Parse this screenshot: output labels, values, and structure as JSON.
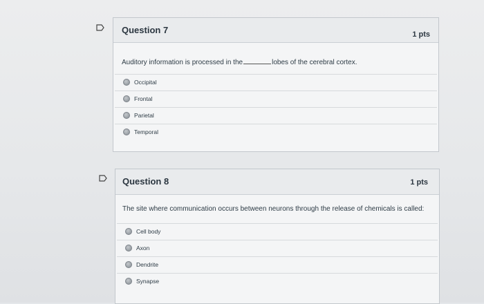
{
  "questions": [
    {
      "title": "Question 7",
      "points": "1 pts",
      "text_before": "Auditory information is processed in the",
      "text_after": "lobes of the cerebral cortex.",
      "answers": [
        "Occipital",
        "Frontal",
        "Parietal",
        "Temporal"
      ]
    },
    {
      "title": "Question 8",
      "points": "1 pts",
      "text": "The site where communication occurs between neurons through the release of chemicals is called:",
      "answers": [
        "Cell body",
        "Axon",
        "Dendrite",
        "Synapse"
      ]
    }
  ],
  "icons": {
    "flag": "flag-icon",
    "radio": "radio-button-icon"
  },
  "colors": {
    "header_bg": "#e9ebed",
    "card_bg": "#f4f5f6",
    "border": "#c2c7cc",
    "text": "#2d3b45"
  }
}
